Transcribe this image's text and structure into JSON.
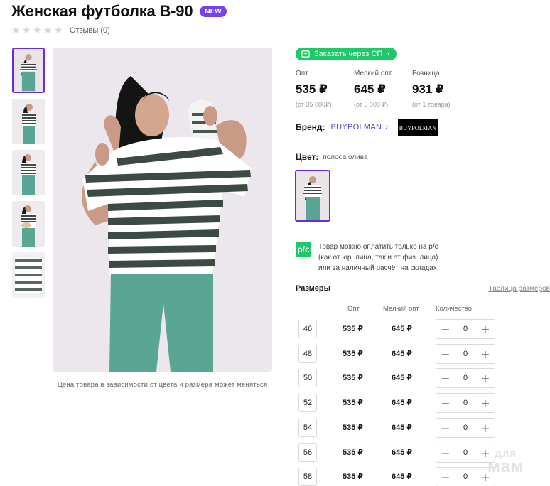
{
  "product": {
    "title": "Женская футболка B-90",
    "badge": "NEW",
    "reviews": "Отзывы (0)",
    "rating_stars": 0,
    "rating_max": 5
  },
  "gallery": {
    "thumbnail_count": 5,
    "active_index": 0,
    "caption": "Цена товара в зависимости от цвета и размера может меняться"
  },
  "buy_button": {
    "label": "Заказать через СП",
    "icon": "cart-icon",
    "chevron": "›"
  },
  "prices": [
    {
      "label": "Опт",
      "value": "535 ₽",
      "sub": "(от 35 000₽)"
    },
    {
      "label": "Мелкий опт",
      "value": "645 ₽",
      "sub": "(от 5 000 ₽)"
    },
    {
      "label": "Розница",
      "value": "931 ₽",
      "sub": "(от 1 товара)"
    }
  ],
  "brand": {
    "label": "Бренд:",
    "name": "BUYPOLMAN",
    "chevron": "›",
    "logo_text": "BUYPOLMAN"
  },
  "color": {
    "label": "Цвет:",
    "value": "полоса олива"
  },
  "payment": {
    "icon_text": "р/с",
    "lines": [
      "Товар можно оплатить только на р/с",
      "(как от юр. лица, так и от физ. лица)",
      "или за наличный расчёт на складах"
    ]
  },
  "sizes": {
    "title": "Размеры",
    "table_link": "Таблица размеров",
    "columns": {
      "opt": "Опт",
      "small_opt": "Мелкий опт",
      "qty": "Количество"
    },
    "minus": "−",
    "plus": "+",
    "rows": [
      {
        "size": "46",
        "opt": "535 ₽",
        "small_opt": "645 ₽",
        "qty": "0"
      },
      {
        "size": "48",
        "opt": "535 ₽",
        "small_opt": "645 ₽",
        "qty": "0"
      },
      {
        "size": "50",
        "opt": "535 ₽",
        "small_opt": "645 ₽",
        "qty": "0"
      },
      {
        "size": "52",
        "opt": "535 ₽",
        "small_opt": "645 ₽",
        "qty": "0"
      },
      {
        "size": "54",
        "opt": "535 ₽",
        "small_opt": "645 ₽",
        "qty": "0"
      },
      {
        "size": "56",
        "opt": "535 ₽",
        "small_opt": "645 ₽",
        "qty": "0"
      },
      {
        "size": "58",
        "opt": "535 ₽",
        "small_opt": "645 ₽",
        "qty": "0"
      }
    ]
  },
  "watermark": {
    "line1": "для",
    "line2": "мам"
  },
  "colors": {
    "accent_purple": "#6a2cd8",
    "brand_link": "#5a3fd6",
    "green": "#1ec96a",
    "badge": "#7b3ff2",
    "stripe_dark": "#3d4a43",
    "pants_teal": "#5aa593"
  }
}
